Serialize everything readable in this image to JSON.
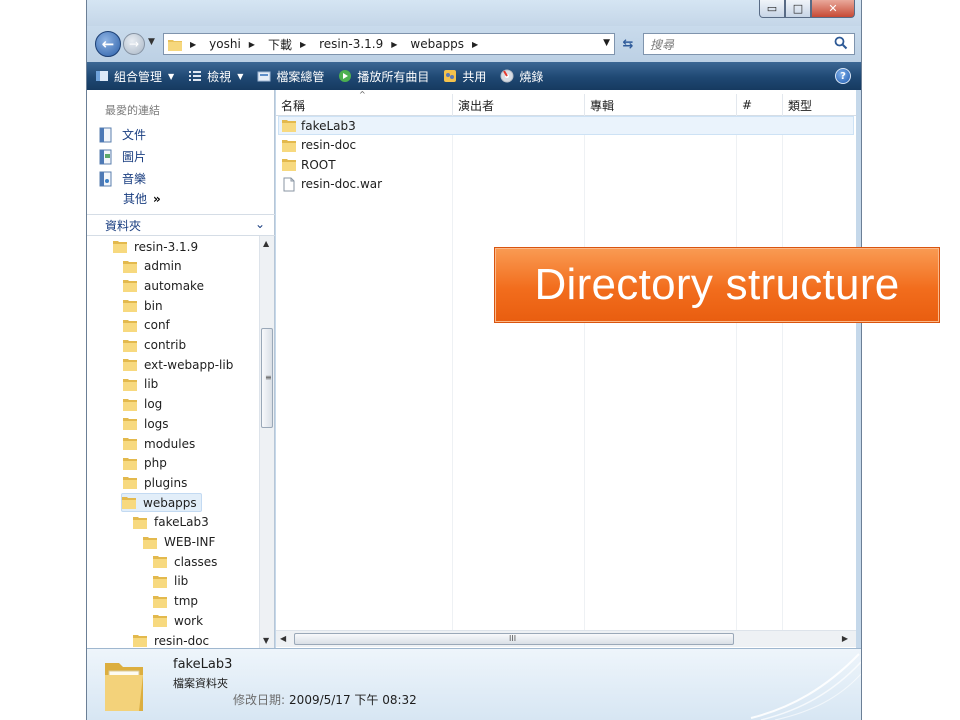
{
  "window": {
    "controls": {
      "minimize": "▭",
      "maximize": "□",
      "close": "✕"
    }
  },
  "address": {
    "breadcrumbs": [
      "yoshi",
      "下載",
      "resin-3.1.9",
      "webapps"
    ],
    "search_placeholder": "搜尋"
  },
  "toolbar": {
    "organize": "組合管理",
    "views": "檢視",
    "share_manage": "檔案總管",
    "play_all": "播放所有曲目",
    "share": "共用",
    "burn": "燒錄",
    "help": "?"
  },
  "favorites": {
    "header": "最愛的連結",
    "items": [
      "文件",
      "圖片",
      "音樂"
    ],
    "more": "其他",
    "more_chevron": "»"
  },
  "folders": {
    "header": "資料夾",
    "tree": [
      {
        "label": "resin-3.1.9",
        "level": 0
      },
      {
        "label": "admin",
        "level": 1
      },
      {
        "label": "automake",
        "level": 1
      },
      {
        "label": "bin",
        "level": 1
      },
      {
        "label": "conf",
        "level": 1
      },
      {
        "label": "contrib",
        "level": 1
      },
      {
        "label": "ext-webapp-lib",
        "level": 1
      },
      {
        "label": "lib",
        "level": 1
      },
      {
        "label": "log",
        "level": 1
      },
      {
        "label": "logs",
        "level": 1
      },
      {
        "label": "modules",
        "level": 1
      },
      {
        "label": "php",
        "level": 1
      },
      {
        "label": "plugins",
        "level": 1
      },
      {
        "label": "webapps",
        "level": 1,
        "selected": true
      },
      {
        "label": "fakeLab3",
        "level": 2
      },
      {
        "label": "WEB-INF",
        "level": 3
      },
      {
        "label": "classes",
        "level": 4
      },
      {
        "label": "lib",
        "level": 4
      },
      {
        "label": "tmp",
        "level": 4
      },
      {
        "label": "work",
        "level": 4
      },
      {
        "label": "resin-doc",
        "level": 2
      }
    ]
  },
  "list": {
    "columns": [
      "名稱",
      "演出者",
      "專輯",
      "#",
      "類型"
    ],
    "files": [
      {
        "name": "fakeLab3",
        "kind": "folder",
        "selected": true
      },
      {
        "name": "resin-doc",
        "kind": "folder"
      },
      {
        "name": "ROOT",
        "kind": "folder"
      },
      {
        "name": "resin-doc.war",
        "kind": "file"
      }
    ],
    "hscroll_grip": "III",
    "vscroll_grip": "≡"
  },
  "details": {
    "name": "fakeLab3",
    "type": "檔案資料夾",
    "modified_label": "修改日期:",
    "modified_value": "2009/5/17 下午 08:32"
  },
  "overlay": {
    "text": "Directory structure",
    "color": "#f26d1d"
  }
}
